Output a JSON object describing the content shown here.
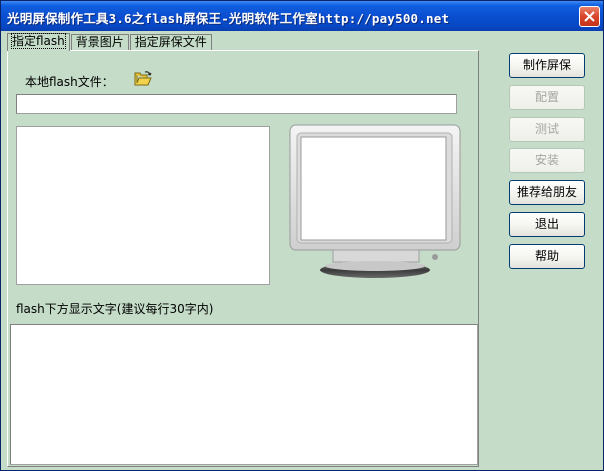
{
  "window": {
    "title": "光明屏保制作工具3.6之flash屏保王-光明软件工作室http://pay500.net",
    "close_icon": "close-icon"
  },
  "tabs": [
    {
      "label": "指定flash",
      "active": true
    },
    {
      "label": "背景图片",
      "active": false
    },
    {
      "label": "指定屏保文件",
      "active": false
    }
  ],
  "panel": {
    "local_file_label": "本地flash文件：",
    "folder_icon": "open-folder-icon",
    "file_path_value": "",
    "caption_label": "flash下方显示文字(建议每行30字内)",
    "caption_value": ""
  },
  "buttons": [
    {
      "label": "制作屏保",
      "enabled": true
    },
    {
      "label": "配置",
      "enabled": false
    },
    {
      "label": "测试",
      "enabled": false
    },
    {
      "label": "安装",
      "enabled": false
    },
    {
      "label": "推荐给朋友",
      "enabled": true
    },
    {
      "label": "退出",
      "enabled": true
    },
    {
      "label": "帮助",
      "enabled": true
    }
  ],
  "colors": {
    "window_bg": "#c4dcc8",
    "titlebar": "#0a4fd0",
    "close_button": "#d9452a"
  }
}
